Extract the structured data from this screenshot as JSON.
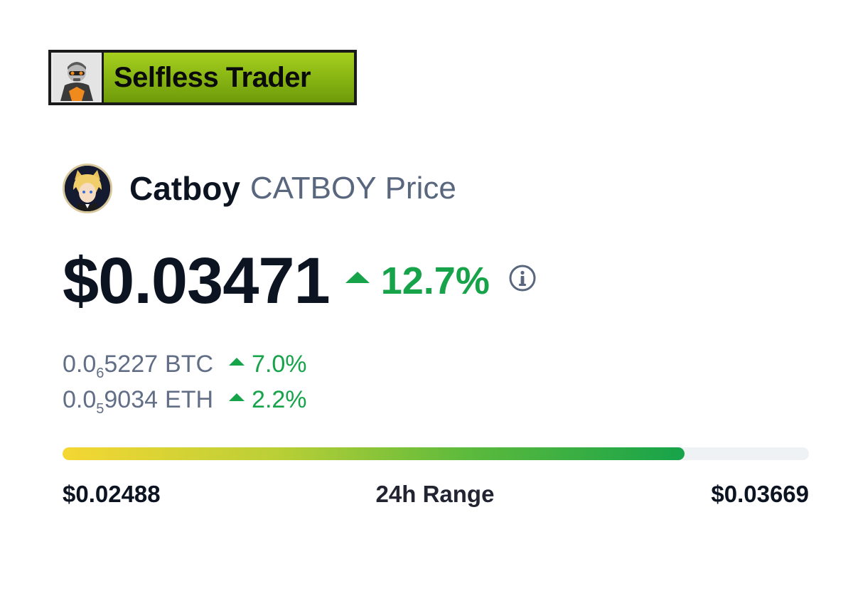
{
  "watermark": {
    "label": "Selfless Trader"
  },
  "coin": {
    "name": "Catboy",
    "symbol": "CATBOY",
    "suffix": "Price"
  },
  "price": {
    "value": "$0.03471",
    "change": "12.7%",
    "change_direction": "up",
    "info_icon": "info-icon"
  },
  "conversions": [
    {
      "prefix": "0.0",
      "zeros_subscript": "6",
      "digits": "5227",
      "unit": "BTC",
      "change": "7.0%"
    },
    {
      "prefix": "0.0",
      "zeros_subscript": "5",
      "digits": "9034",
      "unit": "ETH",
      "change": "2.2%"
    }
  ],
  "range_24h": {
    "title": "24h Range",
    "low": "$0.02488",
    "high": "$0.03669",
    "current_fraction": 0.833
  },
  "colors": {
    "positive": "#16a34a",
    "text_primary": "#0d1421",
    "text_secondary": "#58667e",
    "badge_green": "#8fbf14",
    "range_start": "#f5d733",
    "range_end": "#16a34a",
    "track": "#eff2f5"
  }
}
